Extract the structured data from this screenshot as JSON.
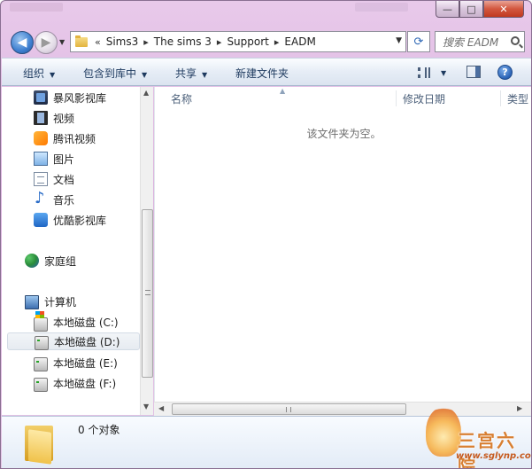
{
  "window": {
    "controls": {
      "minimize": "—",
      "maximize": "□",
      "close": "✕"
    }
  },
  "nav": {
    "back_glyph": "◀",
    "forward_glyph": "▶",
    "recent_glyph": "▼",
    "breadcrumb": [
      "«",
      "Sims3",
      "The sims 3",
      "Support",
      "EADM"
    ],
    "crumb_separator": "▸",
    "address_dropdown_glyph": "▼",
    "refresh_glyph": "⟳",
    "search_placeholder": "搜索 EADM"
  },
  "toolbar": {
    "organize": "组织",
    "include_in_library": "包含到库中",
    "share": "共享",
    "new_folder": "新建文件夹",
    "caret": "▼",
    "help": "?"
  },
  "sidebar": {
    "items": [
      {
        "label": "暴风影视库",
        "icon": "video-library-icon"
      },
      {
        "label": "视频",
        "icon": "film-icon"
      },
      {
        "label": "腾讯视频",
        "icon": "tencent-video-icon"
      },
      {
        "label": "图片",
        "icon": "pictures-icon"
      },
      {
        "label": "文档",
        "icon": "documents-icon"
      },
      {
        "label": "音乐",
        "icon": "music-icon"
      },
      {
        "label": "优酷影视库",
        "icon": "youku-icon"
      }
    ],
    "homegroup": "家庭组",
    "computer": "计算机",
    "drives": [
      {
        "label": "本地磁盘 (C:)",
        "selected": false
      },
      {
        "label": "本地磁盘 (D:)",
        "selected": true
      },
      {
        "label": "本地磁盘 (E:)",
        "selected": false
      },
      {
        "label": "本地磁盘 (F:)",
        "selected": false
      }
    ]
  },
  "content": {
    "columns": [
      "名称",
      "修改日期",
      "类型"
    ],
    "sort_glyph": "▲",
    "empty_message": "该文件夹为空。"
  },
  "scroll": {
    "up": "▲",
    "down": "▼",
    "left": "◀",
    "right": "▶"
  },
  "details": {
    "count": "0 个对象"
  },
  "watermark": {
    "title": "三宫六院",
    "url": "www.sglynp.com"
  }
}
